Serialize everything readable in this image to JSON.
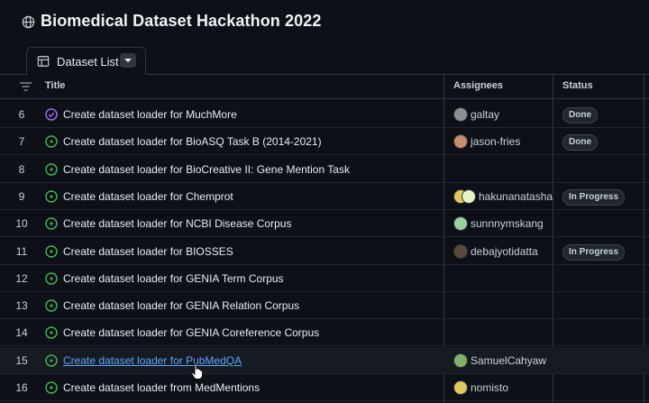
{
  "project": {
    "title": "Biomedical Dataset Hackathon 2022"
  },
  "tab": {
    "label": "Dataset List"
  },
  "columns": {
    "title": "Title",
    "assignees": "Assignees",
    "status": "Status"
  },
  "colors": {
    "open": "#3fb950",
    "closed": "#a371f7",
    "link": "#58a6ff",
    "background": "#0d1117"
  },
  "rows": [
    {
      "num": "6",
      "title": "Create dataset loader for MuchMore",
      "state": "closed",
      "assignee": "galtay",
      "status": "Done"
    },
    {
      "num": "7",
      "title": "Create dataset loader for BioASQ Task B (2014-2021)",
      "state": "open",
      "assignee": "jason-fries",
      "status": "Done"
    },
    {
      "num": "8",
      "title": "Create dataset loader for BioCreative II: Gene Mention Task",
      "state": "open",
      "assignee": "",
      "status": ""
    },
    {
      "num": "9",
      "title": "Create dataset loader for Chemprot",
      "state": "open",
      "assignee": "hakunanatasha",
      "status": "In Progress"
    },
    {
      "num": "10",
      "title": "Create dataset loader for NCBI Disease Corpus",
      "state": "open",
      "assignee": "sunnnymskang",
      "status": ""
    },
    {
      "num": "11",
      "title": "Create dataset loader for BIOSSES",
      "state": "open",
      "assignee": "debajyotidatta",
      "status": "In Progress"
    },
    {
      "num": "12",
      "title": "Create dataset loader for GENIA Term Corpus",
      "state": "open",
      "assignee": "",
      "status": ""
    },
    {
      "num": "13",
      "title": "Create dataset loader for GENIA Relation Corpus",
      "state": "open",
      "assignee": "",
      "status": ""
    },
    {
      "num": "14",
      "title": "Create dataset loader for GENIA Coreference Corpus",
      "state": "open",
      "assignee": "",
      "status": ""
    },
    {
      "num": "15",
      "title": "Create dataset loader for PubMedQA",
      "state": "open",
      "assignee": "SamuelCahyaw",
      "status": ""
    },
    {
      "num": "16",
      "title": "Create dataset loader from MedMentions",
      "state": "open",
      "assignee": "nomisto",
      "status": ""
    }
  ]
}
